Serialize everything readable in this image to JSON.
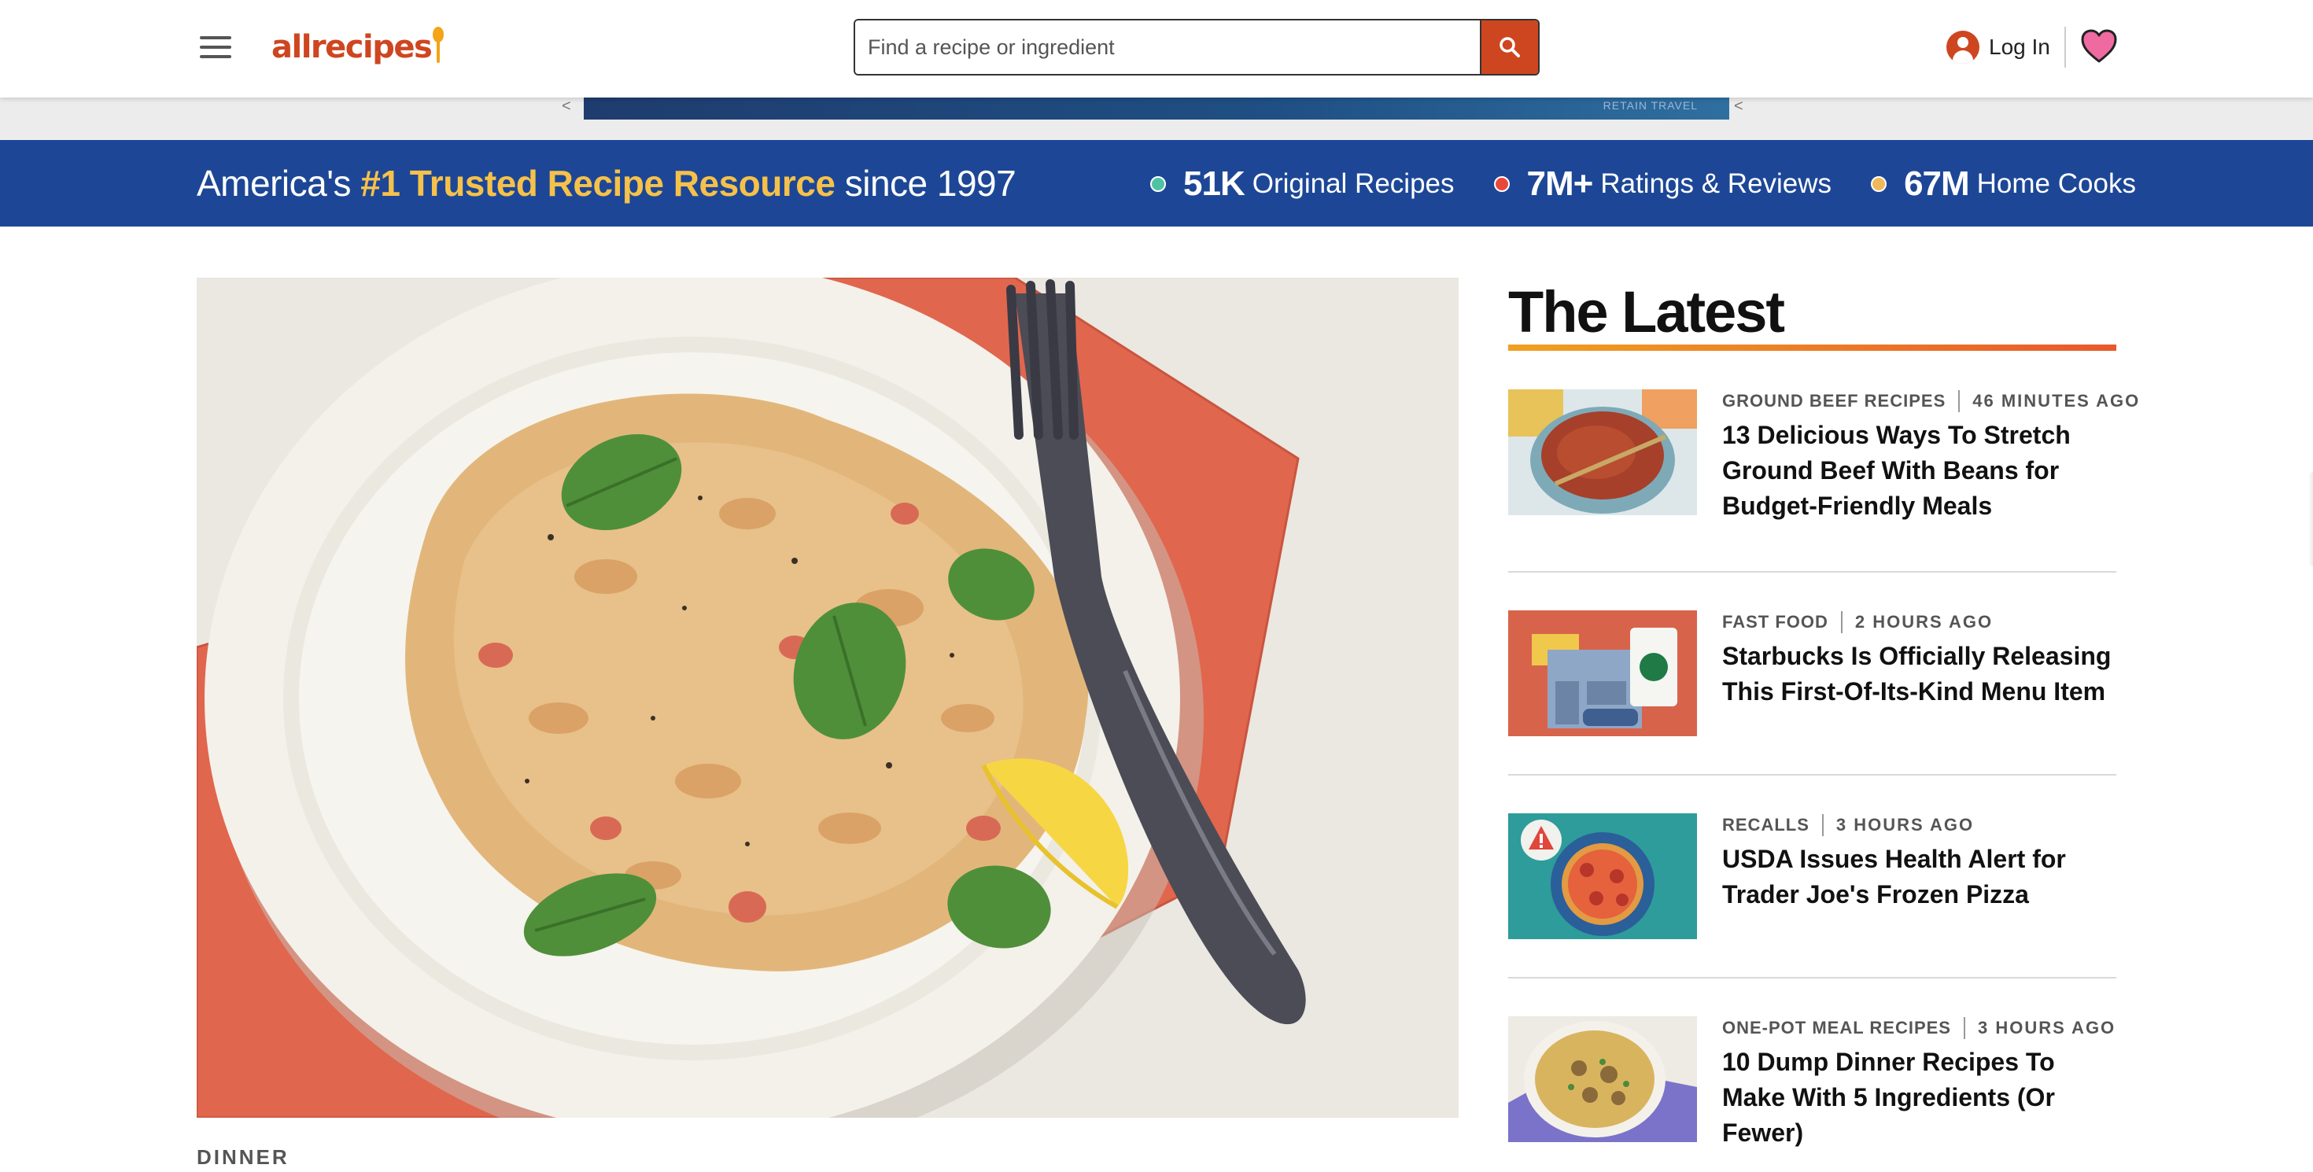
{
  "header": {
    "logo_text": "allrecipes",
    "search_placeholder": "Find a recipe or ingredient",
    "login_label": "Log In",
    "icons": {
      "menu": "hamburger-menu-icon",
      "search": "search-icon",
      "user": "user-avatar-icon",
      "favorites": "heart-icon"
    }
  },
  "ad": {
    "text": "RETAIN TRAVEL",
    "marker_left": "<",
    "marker_right": "<"
  },
  "banner": {
    "headline_pre": "America's",
    "headline_highlight": "#1 Trusted Recipe Resource",
    "headline_post": "since 1997",
    "stats": [
      {
        "value": "51K",
        "label": "Original Recipes",
        "dot_color": "#4fc3a1"
      },
      {
        "value": "7M+",
        "label": "Ratings & Reviews",
        "dot_color": "#e8483a"
      },
      {
        "value": "67M",
        "label": "Home Cooks",
        "dot_color": "#f0b85a"
      }
    ]
  },
  "hero": {
    "category": "DINNER",
    "image": "creamy-orzo-with-spinach-basil-lemon-photo"
  },
  "latest": {
    "title": "The Latest",
    "items": [
      {
        "category": "GROUND BEEF RECIPES",
        "time": "46 MINUTES AGO",
        "title": "13 Delicious Ways To Stretch Ground Beef With Beans for Budget-Friendly Meals",
        "image": "chili-pot-photo"
      },
      {
        "category": "FAST FOOD",
        "time": "2 HOURS AGO",
        "title": "Starbucks Is Officially Releasing This First-Of-Its-Kind Menu Item",
        "image": "starbucks-store-illustration"
      },
      {
        "category": "RECALLS",
        "time": "3 HOURS AGO",
        "title": "USDA Issues Health Alert for Trader Joe's Frozen Pizza",
        "image": "pizza-alert-photo"
      },
      {
        "category": "ONE-POT MEAL RECIPES",
        "time": "3 HOURS AGO",
        "title": "10 Dump Dinner Recipes To Make With 5 Ingredients (Or Fewer)",
        "image": "pasta-bowl-photo"
      }
    ]
  },
  "colors": {
    "brand": "#ce4620",
    "banner": "#1d4796",
    "highlight": "#f6c14a"
  }
}
